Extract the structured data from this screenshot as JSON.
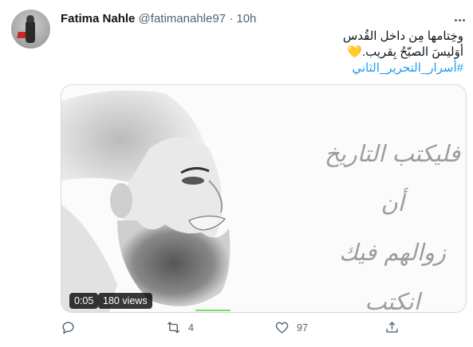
{
  "user": {
    "name": "Fatima Nahle",
    "handle": "@fatimanahle97",
    "separator": "·",
    "time": "10h"
  },
  "tweet": {
    "line1": "وخِتامها مِن داخل القُدس",
    "line2_text": "أوَليسَ الصبّحُ بِقريب.",
    "emoji": "💛",
    "hashtag": "#أسرار_التحرير_الثاني"
  },
  "media": {
    "calligraphy_line1": "فليكتب التاريخ أن",
    "calligraphy_line2": "زوالهم فيك انكتب",
    "duration": "0:05",
    "views": "180 views",
    "playback_progress_percent": 2
  },
  "actions": {
    "reply_count": "",
    "retweet_count": "4",
    "like_count": "97",
    "icons": [
      "reply-icon",
      "retweet-icon",
      "like-icon",
      "share-icon"
    ]
  },
  "colors": {
    "accent": "#1d9bf0",
    "secondary_text": "#536471",
    "progress": "#7bdc6b"
  }
}
